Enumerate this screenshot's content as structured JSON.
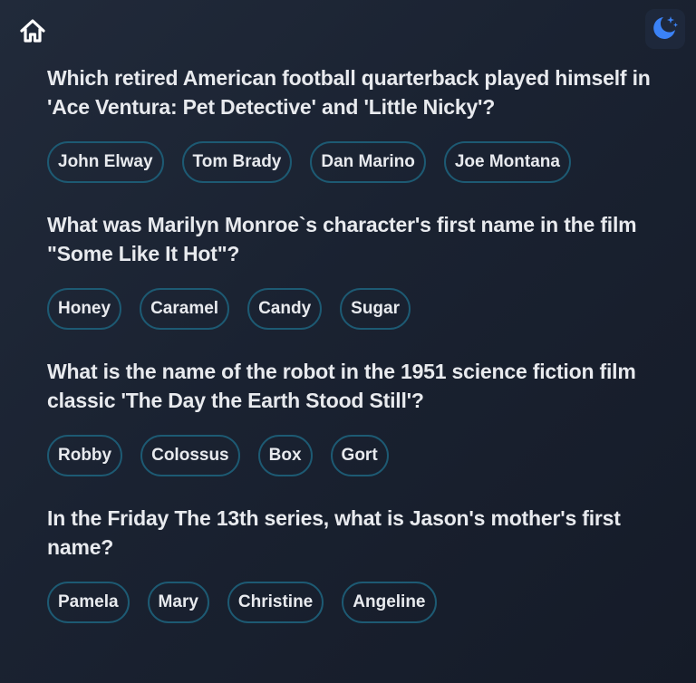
{
  "header": {
    "home_icon": "home-icon",
    "theme_icon": "moon-stars-icon",
    "accent_color": "#3b82f6",
    "pill_border_color": "#1d5a73"
  },
  "questions": [
    {
      "text": "Which retired American football quarterback played himself in 'Ace Ventura: Pet Detective' and 'Little Nicky'?",
      "answers": [
        "John Elway",
        "Tom Brady",
        "Dan Marino",
        "Joe Montana"
      ]
    },
    {
      "text": "What was Marilyn Monroe`s character's first name in the film \"Some Like It Hot\"?",
      "answers": [
        "Honey",
        "Caramel",
        "Candy",
        "Sugar"
      ]
    },
    {
      "text": "What is the name of the robot in the 1951 science fiction film classic 'The Day the Earth Stood Still'?",
      "answers": [
        "Robby",
        "Colossus",
        "Box",
        "Gort"
      ]
    },
    {
      "text": "In the Friday The 13th series, what is Jason's mother's first name?",
      "answers": [
        "Pamela",
        "Mary",
        "Christine",
        "Angeline"
      ]
    }
  ]
}
